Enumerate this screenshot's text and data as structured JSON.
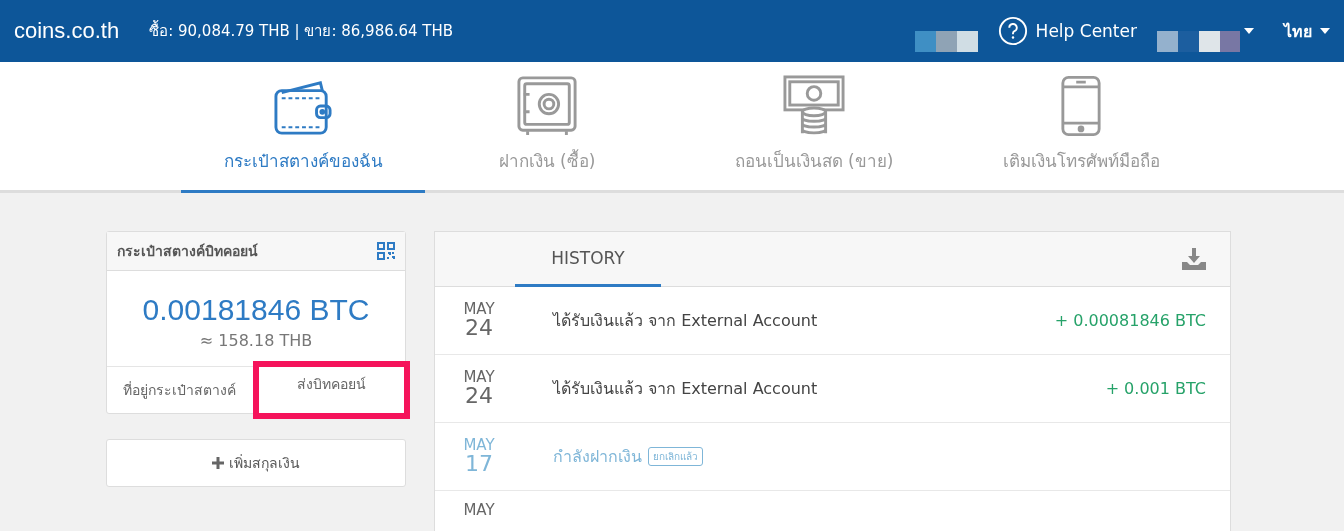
{
  "header": {
    "logo": "coins.co.th",
    "rates": "ซื้อ: 90,084.79 THB | ขาย: 86,986.64 THB",
    "help": "Help Center",
    "language": "ไทย"
  },
  "tabs": [
    {
      "label": "กระเป๋าสตางค์ของฉัน",
      "kind": "wallet",
      "selected": true
    },
    {
      "label": "ฝากเงิน (ซื้อ)",
      "kind": "safe",
      "selected": false
    },
    {
      "label": "ถอนเป็นเงินสด (ขาย)",
      "kind": "cash",
      "selected": false
    },
    {
      "label": "เติมเงินโทรศัพท์มือถือ",
      "kind": "phone",
      "selected": false
    }
  ],
  "wallet": {
    "title": "กระเป๋าสตางค์บิทคอยน์",
    "balance": "0.00181846 BTC",
    "fiat": "≈ 158.18 THB",
    "actions": [
      {
        "label": "ที่อยู่กระเป๋าสตางค์",
        "highlighted": false
      },
      {
        "label": "ส่งบิทคอยน์",
        "highlighted": true
      }
    ]
  },
  "add_currency": "เพิ่มสกุลเงิน",
  "history": {
    "tab": "HISTORY",
    "rows": [
      {
        "month": "MAY",
        "day": "24",
        "title": "ได้รับเงินแล้ว จาก External Account",
        "amount": "+ 0.00081846 BTC",
        "faded": false
      },
      {
        "month": "MAY",
        "day": "24",
        "title": "ได้รับเงินแล้ว จาก External Account",
        "amount": "+ 0.001 BTC",
        "faded": false
      },
      {
        "month": "MAY",
        "day": "17",
        "title": "กำลังฝากเงิน",
        "tag": "ยกเลิกแล้ว",
        "faded": true
      },
      {
        "month": "MAY",
        "faded": false
      }
    ]
  }
}
